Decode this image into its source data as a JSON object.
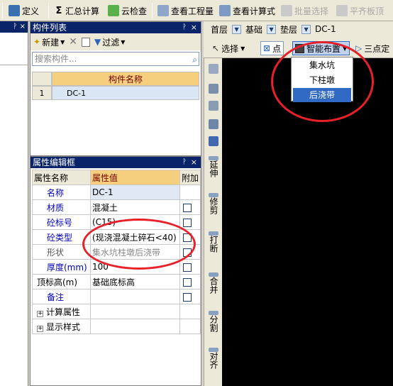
{
  "toolbar": {
    "items": [
      {
        "label": "定义",
        "icon": "define-icon",
        "disabled": false
      },
      {
        "label": "汇总计算",
        "icon": "sigma-icon",
        "disabled": false
      },
      {
        "label": "云检查",
        "icon": "cloud-check-icon",
        "disabled": false
      },
      {
        "label": "查看工程量",
        "icon": "view-quantity-icon",
        "disabled": false
      },
      {
        "label": "查看计算式",
        "icon": "view-formula-icon",
        "disabled": false
      },
      {
        "label": "批量选择",
        "icon": "batch-select-icon",
        "disabled": true
      },
      {
        "label": "平齐板顶",
        "icon": "align-slab-top-icon",
        "disabled": true
      }
    ]
  },
  "component_list": {
    "title": "构件列表",
    "new_label": "新建",
    "filter_label": "过滤",
    "search_placeholder": "搜索构件...",
    "column_header": "构件名称",
    "rows": [
      {
        "index": "1",
        "name": "DC-1"
      }
    ]
  },
  "property_editor": {
    "title": "属性编辑框",
    "headers": {
      "name": "属性名称",
      "value": "属性值",
      "extra": "附加"
    },
    "rows": [
      {
        "name": "名称",
        "value": "DC-1",
        "style": "blue",
        "checkbox": false
      },
      {
        "name": "材质",
        "value": "混凝土",
        "style": "blue",
        "checkbox": true
      },
      {
        "name": "砼标号",
        "value": "(C15)",
        "style": "blue",
        "checkbox": true
      },
      {
        "name": "砼类型",
        "value": "(现浇混凝土碎石<40)",
        "style": "blue",
        "checkbox": true
      },
      {
        "name": "形状",
        "value": "集水坑柱墩后浇带",
        "style": "gray",
        "checkbox": true
      },
      {
        "name": "厚度(mm)",
        "value": "100",
        "style": "blue",
        "checkbox": true
      },
      {
        "name": "顶标高(m)",
        "value": "基础底标高",
        "style": "plain",
        "checkbox": true
      },
      {
        "name": "备注",
        "value": "",
        "style": "blue",
        "checkbox": true
      },
      {
        "name": "计算属性",
        "value": "",
        "style": "expand",
        "checkbox": false
      },
      {
        "name": "显示样式",
        "value": "",
        "style": "expand",
        "checkbox": false
      }
    ]
  },
  "layer_bar": {
    "floor": "首层",
    "category": "基础",
    "type": "垫层",
    "component": "DC-1"
  },
  "sub_toolbar": {
    "select_label": "选择",
    "point_label": "点",
    "smart_layout_label": "智能布置",
    "three_point_label": "三点定"
  },
  "dropdown": {
    "items": [
      "集水坑",
      "下柱墩",
      "后浇带"
    ],
    "selected_index": 2
  },
  "vertical_tools": {
    "extend_label": "延伸",
    "trim_label": "修剪",
    "break_label": "打断",
    "merge_label": "合并",
    "split_label": "分割",
    "align_label": "对齐"
  },
  "colors": {
    "title_bar": "#0a246a",
    "header_orange": "#f5cf7e",
    "annotation_red": "#e8202a",
    "selection_blue": "#316ac5",
    "canvas": "#000000"
  }
}
